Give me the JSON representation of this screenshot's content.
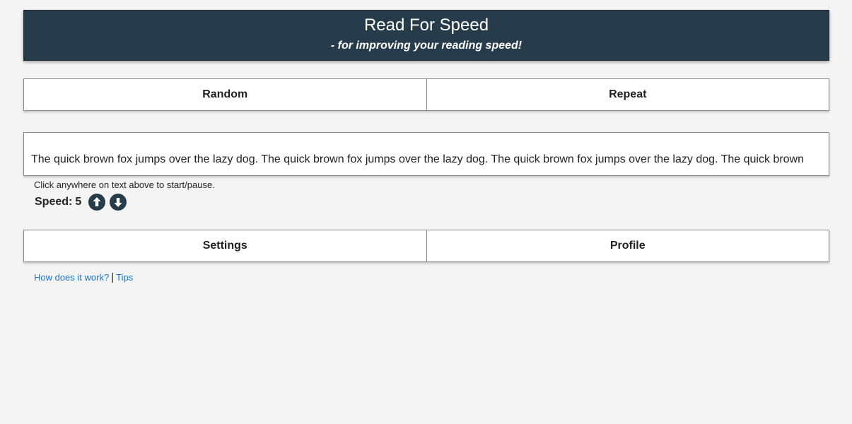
{
  "header": {
    "title": "Read For Speed",
    "subtitle": "- for improving your reading speed!"
  },
  "top_buttons": {
    "random": "Random",
    "repeat": "Repeat"
  },
  "reader": {
    "text": "The quick brown fox jumps over the lazy dog. The quick brown fox jumps over the lazy dog. The quick brown fox jumps over the lazy dog. The quick brown"
  },
  "hint": "Click anywhere on text above to start/pause.",
  "speed": {
    "label": "Speed:",
    "value": "5",
    "up_icon": "arrow-up-circle",
    "down_icon": "arrow-down-circle"
  },
  "bottom_buttons": {
    "settings": "Settings",
    "profile": "Profile"
  },
  "links": {
    "how": "How does it work?",
    "separator": "|",
    "tips": "Tips"
  },
  "colors": {
    "header_bg": "#273c4a",
    "link": "#1a73c8",
    "page_bg": "#f4f4f4"
  }
}
